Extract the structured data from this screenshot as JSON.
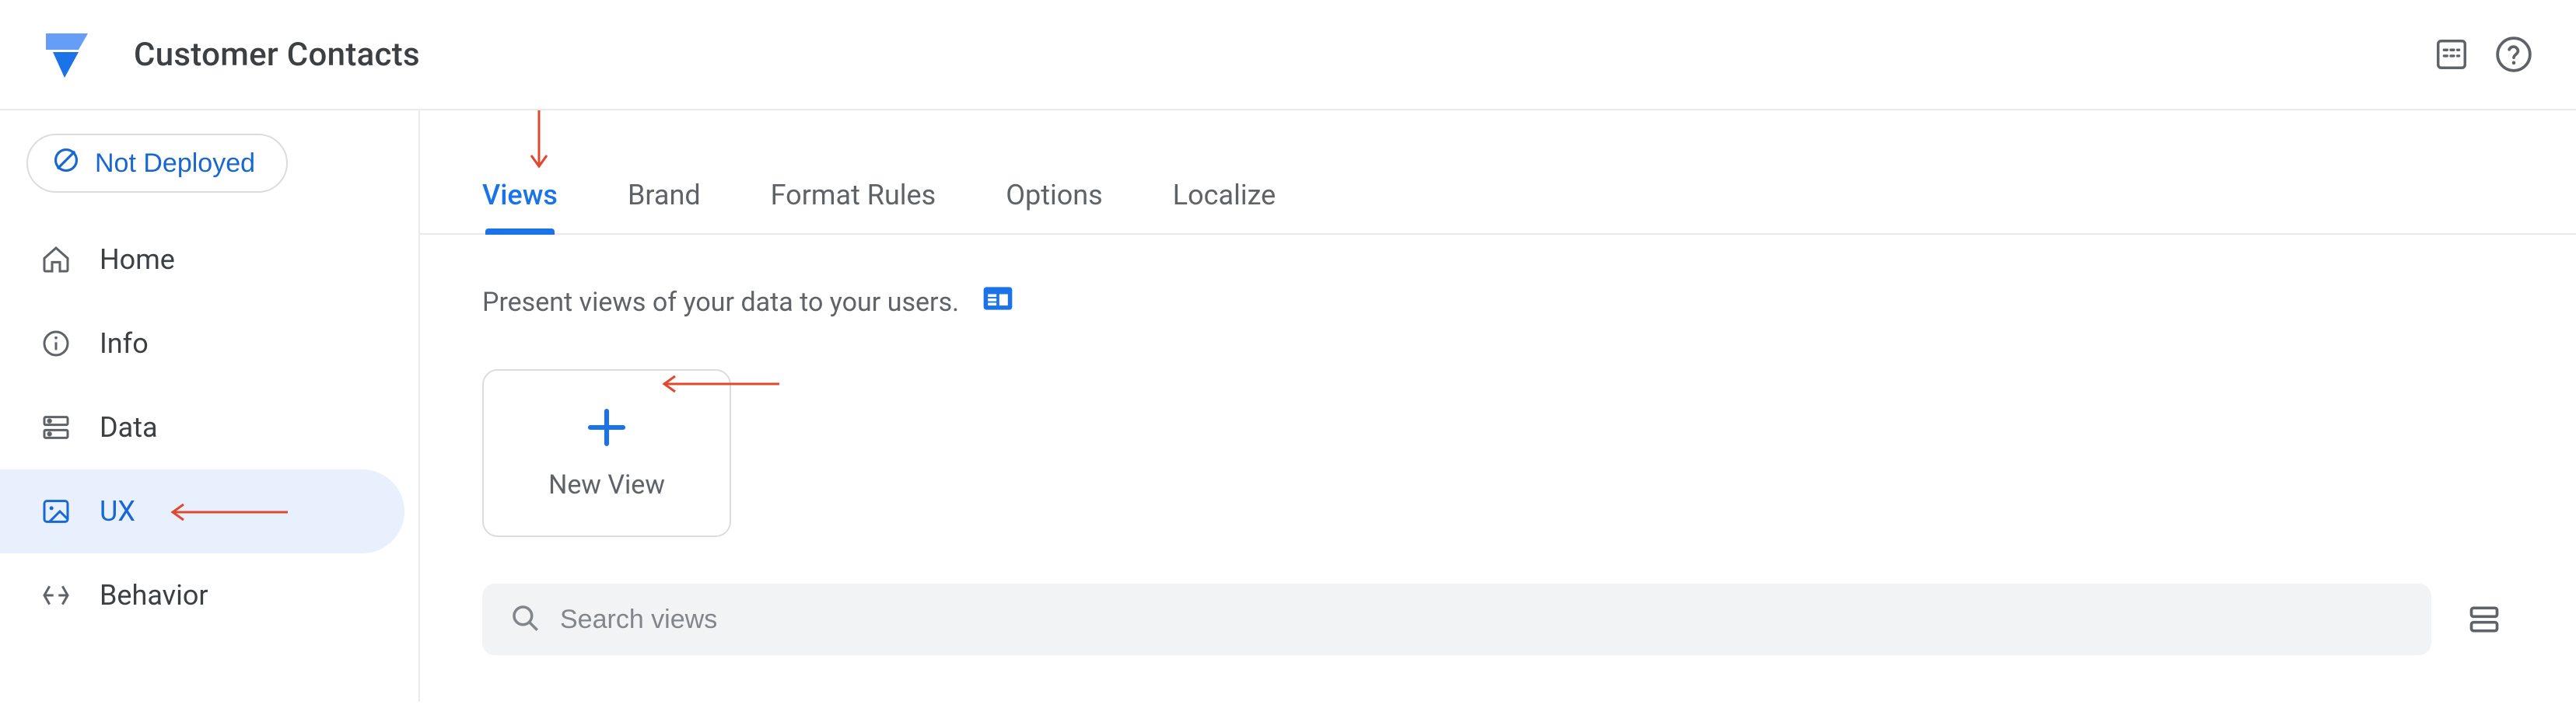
{
  "app": {
    "title": "Customer Contacts"
  },
  "deploy_status": "Not Deployed",
  "sidebar": {
    "items": [
      {
        "label": "Home"
      },
      {
        "label": "Info"
      },
      {
        "label": "Data"
      },
      {
        "label": "UX"
      },
      {
        "label": "Behavior"
      }
    ],
    "active_index": 3
  },
  "tabs": {
    "items": [
      {
        "label": "Views"
      },
      {
        "label": "Brand"
      },
      {
        "label": "Format Rules"
      },
      {
        "label": "Options"
      },
      {
        "label": "Localize"
      }
    ],
    "active_index": 0
  },
  "views_tab": {
    "subtitle": "Present views of your data to your users.",
    "new_view_label": "New View",
    "search_placeholder": "Search views"
  }
}
